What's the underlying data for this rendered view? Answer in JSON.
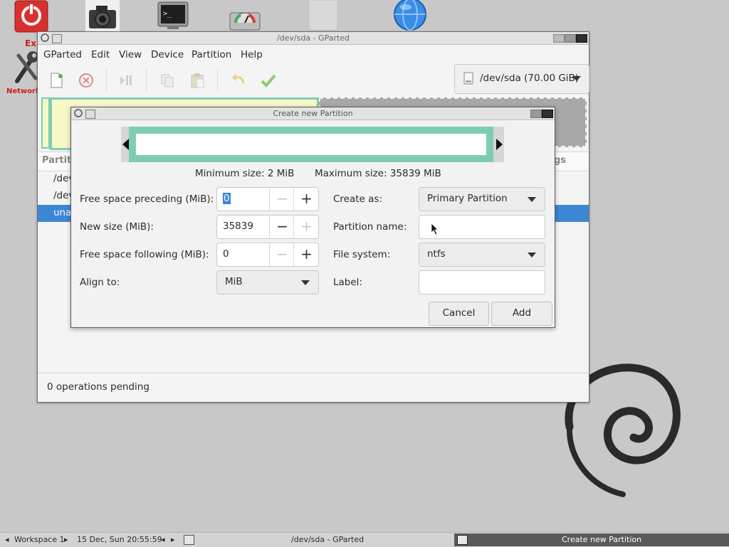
{
  "desktop": {
    "exit_label": "Ex",
    "network_label": "Network",
    "icons": [
      "power-icon",
      "camera-icon",
      "terminal-icon",
      "disk-gauge-icon",
      "blank-document-icon",
      "globe-icon"
    ]
  },
  "main_window": {
    "title": "/dev/sda - GParted",
    "menu": [
      "GParted",
      "Edit",
      "View",
      "Device",
      "Partition",
      "Help"
    ],
    "device_selector": "/dev/sda (70.00 GiB)",
    "list_header_left": "Partiti",
    "list_header_right": "gs",
    "rows": [
      "/dev",
      "/dev",
      "una"
    ],
    "status": "0 operations pending"
  },
  "dialog": {
    "title": "Create new Partition",
    "min_size": "Minimum size: 2 MiB",
    "max_size": "Maximum size: 35839 MiB",
    "free_preceding": {
      "label": "Free space preceding (MiB):",
      "value": "0"
    },
    "new_size": {
      "label": "New size (MiB):",
      "value": "35839"
    },
    "free_following": {
      "label": "Free space following (MiB):",
      "value": "0"
    },
    "align_to": {
      "label": "Align to:",
      "value": "MiB"
    },
    "create_as": {
      "label": "Create as:",
      "value": "Primary Partition"
    },
    "partition_name": {
      "label": "Partition name:",
      "value": ""
    },
    "file_system": {
      "label": "File system:",
      "value": "ntfs"
    },
    "label": {
      "label": "Label:",
      "value": ""
    },
    "cancel": "Cancel",
    "add": "Add"
  },
  "taskbar": {
    "workspace": "Workspace 1",
    "datetime": "15 Dec, Sun 20:55:59",
    "task1": "/dev/sda - GParted",
    "task2": "Create new Partition"
  },
  "colors": {
    "partition_green": "#7fcdb0",
    "selection_blue": "#3d86d6",
    "unallocated_gray": "#a8a8a8",
    "partition_yellow": "#f7f7c8"
  }
}
